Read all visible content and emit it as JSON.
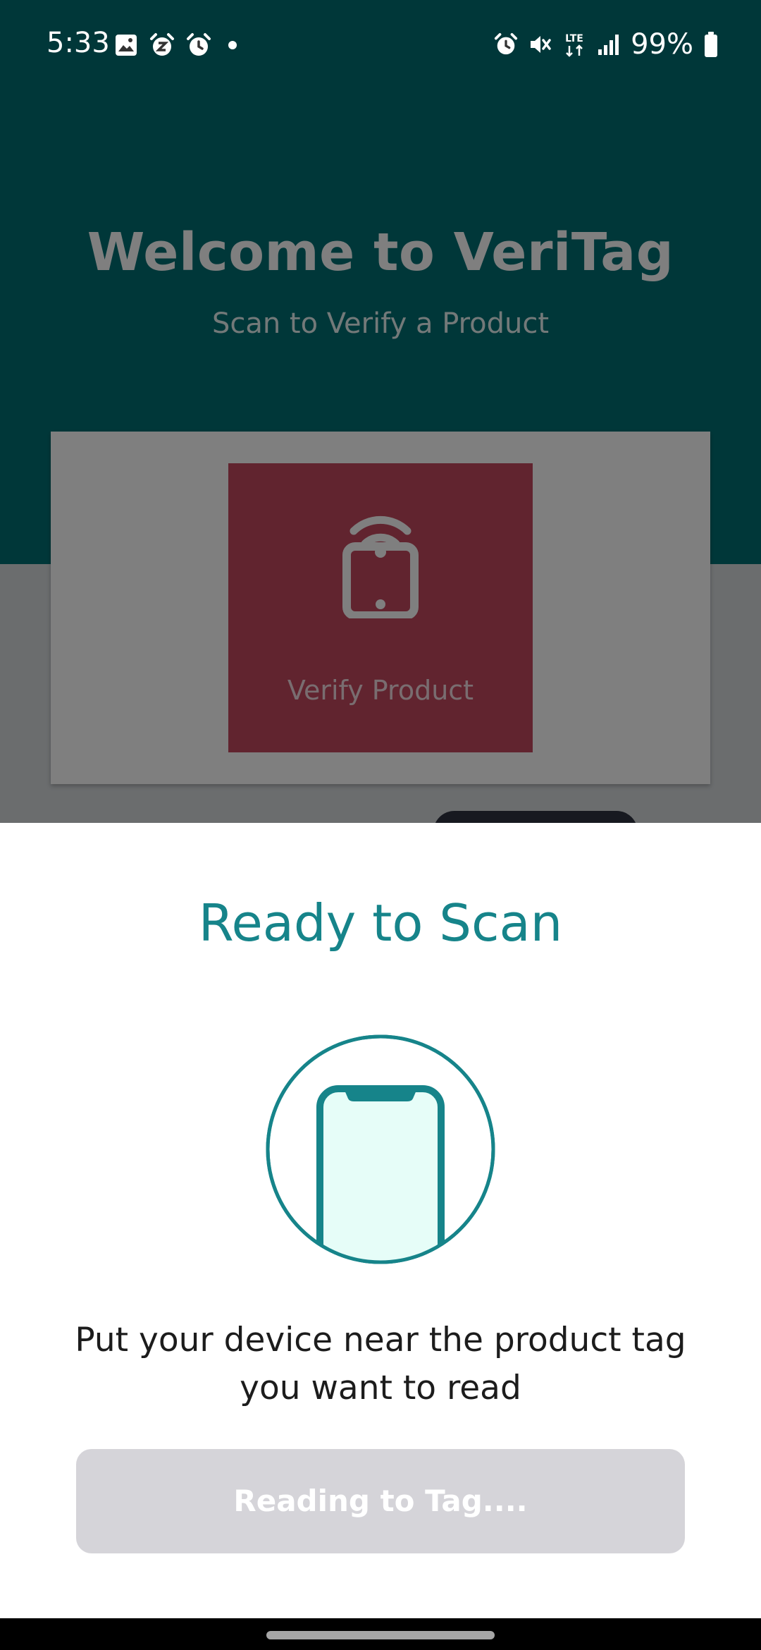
{
  "status_bar": {
    "time": "5:33",
    "battery_percent": "99%",
    "network": "LTE",
    "left_icons": [
      "image-icon",
      "alarm-snooze-icon",
      "alarm-icon",
      "dot-icon"
    ],
    "right_icons": [
      "alarm-icon",
      "mute-icon",
      "lte-icon",
      "signal-icon",
      "battery-icon"
    ]
  },
  "app": {
    "title": "Welcome to VeriTag",
    "subtitle": "Scan to Verify a Product",
    "verify_tile": {
      "label": "Verify Product",
      "icon": "nfc-phone-icon"
    }
  },
  "sheet": {
    "title": "Ready to Scan",
    "graphic": "phone-scan-icon",
    "message": "Put your device near the product tag you want to read",
    "button_label": "Reading to Tag...."
  },
  "colors": {
    "header_teal": "#006f73",
    "accent_teal": "#16848a",
    "verify_tile_red": "#c2485e",
    "button_disabled": "#d5d4d9",
    "phone_fill": "#e6fdf8"
  }
}
